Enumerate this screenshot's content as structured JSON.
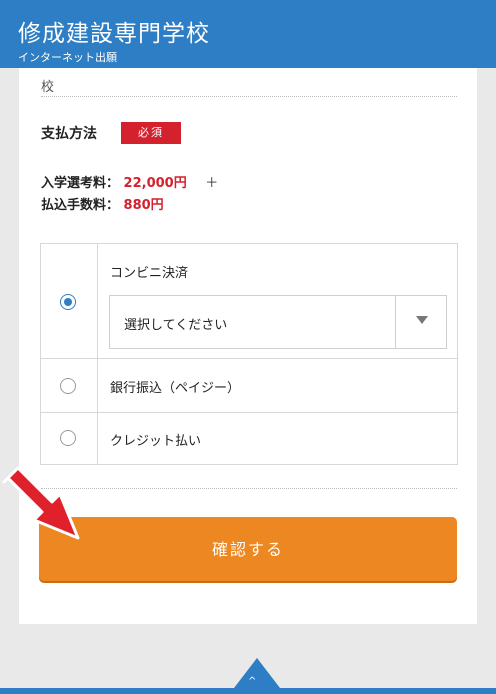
{
  "header": {
    "school_name": "修成建設専門学校",
    "subtitle": "インターネット出願"
  },
  "form": {
    "cut_off_text": "校",
    "payment_label": "支払方法",
    "required_badge": "必須",
    "exam_fee_label": "入学選考料：",
    "exam_fee_value": "22,000円",
    "plus_sign": "＋",
    "handling_fee_label": "払込手数料：",
    "handling_fee_value": "880円",
    "options": [
      {
        "label": "コンビニ決済",
        "selected": true
      },
      {
        "label": "銀行振込（ペイジー）",
        "selected": false
      },
      {
        "label": "クレジット払い",
        "selected": false
      }
    ],
    "select_placeholder": "選択してください",
    "confirm_button": "確認する"
  },
  "icons": {
    "dropdown": "chevron-down-icon",
    "annotation": "red-arrow-icon",
    "page_top": "chevron-up-icon"
  },
  "colors": {
    "header": "#2d7ec4",
    "required": "#d3212d",
    "price": "#d3212d",
    "confirm_button": "#ed8721",
    "annotation_arrow": "#e0202a"
  }
}
